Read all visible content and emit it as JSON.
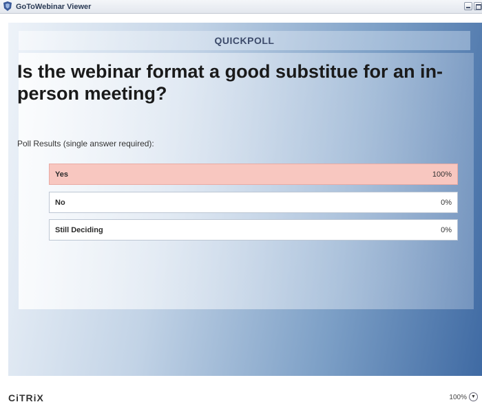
{
  "window": {
    "title": "GoToWebinar Viewer"
  },
  "poll": {
    "header": "QUICKPOLL",
    "question": "Is the webinar format a good substitue for an in-person meeting?",
    "subtitle": "Poll Results (single answer required):",
    "options": [
      {
        "label": "Yes",
        "percent": "100%",
        "selected": true
      },
      {
        "label": "No",
        "percent": "0%",
        "selected": false
      },
      {
        "label": "Still Deciding",
        "percent": "0%",
        "selected": false
      }
    ]
  },
  "footer": {
    "brand": "CiTRiX",
    "zoom": "100%"
  },
  "colors": {
    "selected_option": "#f8c7c0",
    "stage_dark": "#3f6aa3",
    "stage_light": "#eef3f9"
  },
  "icons": {
    "app": "gotowebinar-app-icon",
    "minimize": "minimize-icon",
    "maximize": "maximize-icon",
    "zoom": "chevron-down-icon"
  }
}
